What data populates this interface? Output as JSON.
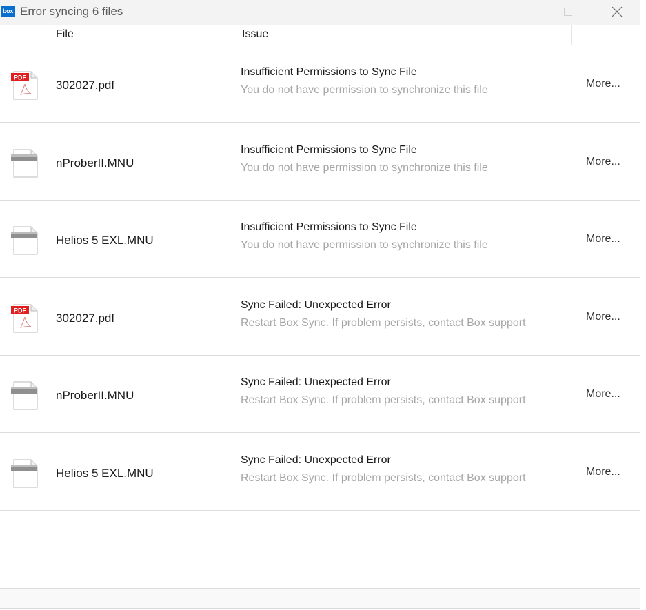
{
  "window": {
    "app_logo_text": "box",
    "title": "Error syncing 6 files",
    "minimize_icon": "minimize-icon",
    "maximize_icon": "maximize-icon",
    "close_icon": "close-icon"
  },
  "columns": {
    "file": "File",
    "issue": "Issue"
  },
  "rows": [
    {
      "icon": "pdf-file-icon",
      "badge": "PDF",
      "file": "302027.pdf",
      "issue": "Insufficient Permissions to Sync File",
      "detail": "You do not have permission to synchronize this file",
      "more": "More..."
    },
    {
      "icon": "generic-file-icon",
      "badge": "",
      "file": "nProberII.MNU",
      "issue": "Insufficient Permissions to Sync File",
      "detail": "You do not have permission to synchronize this file",
      "more": "More..."
    },
    {
      "icon": "generic-file-icon",
      "badge": "",
      "file": "Helios 5 EXL.MNU",
      "issue": "Insufficient Permissions to Sync File",
      "detail": "You do not have permission to synchronize this file",
      "more": "More..."
    },
    {
      "icon": "pdf-file-icon",
      "badge": "PDF",
      "file": "302027.pdf",
      "issue": "Sync Failed: Unexpected Error",
      "detail": "Restart Box Sync. If problem persists, contact Box support",
      "more": "More..."
    },
    {
      "icon": "generic-file-icon",
      "badge": "",
      "file": "nProberII.MNU",
      "issue": "Sync Failed: Unexpected Error",
      "detail": "Restart Box Sync. If problem persists, contact Box support",
      "more": "More..."
    },
    {
      "icon": "generic-file-icon",
      "badge": "",
      "file": "Helios 5 EXL.MNU",
      "issue": "Sync Failed: Unexpected Error",
      "detail": "Restart Box Sync. If problem persists, contact Box support",
      "more": "More..."
    }
  ],
  "colors": {
    "title_text": "#5c5c5c",
    "detail_text": "#a6a6a6",
    "pdf_badge": "#e02020",
    "logo": "#0a6fce"
  }
}
